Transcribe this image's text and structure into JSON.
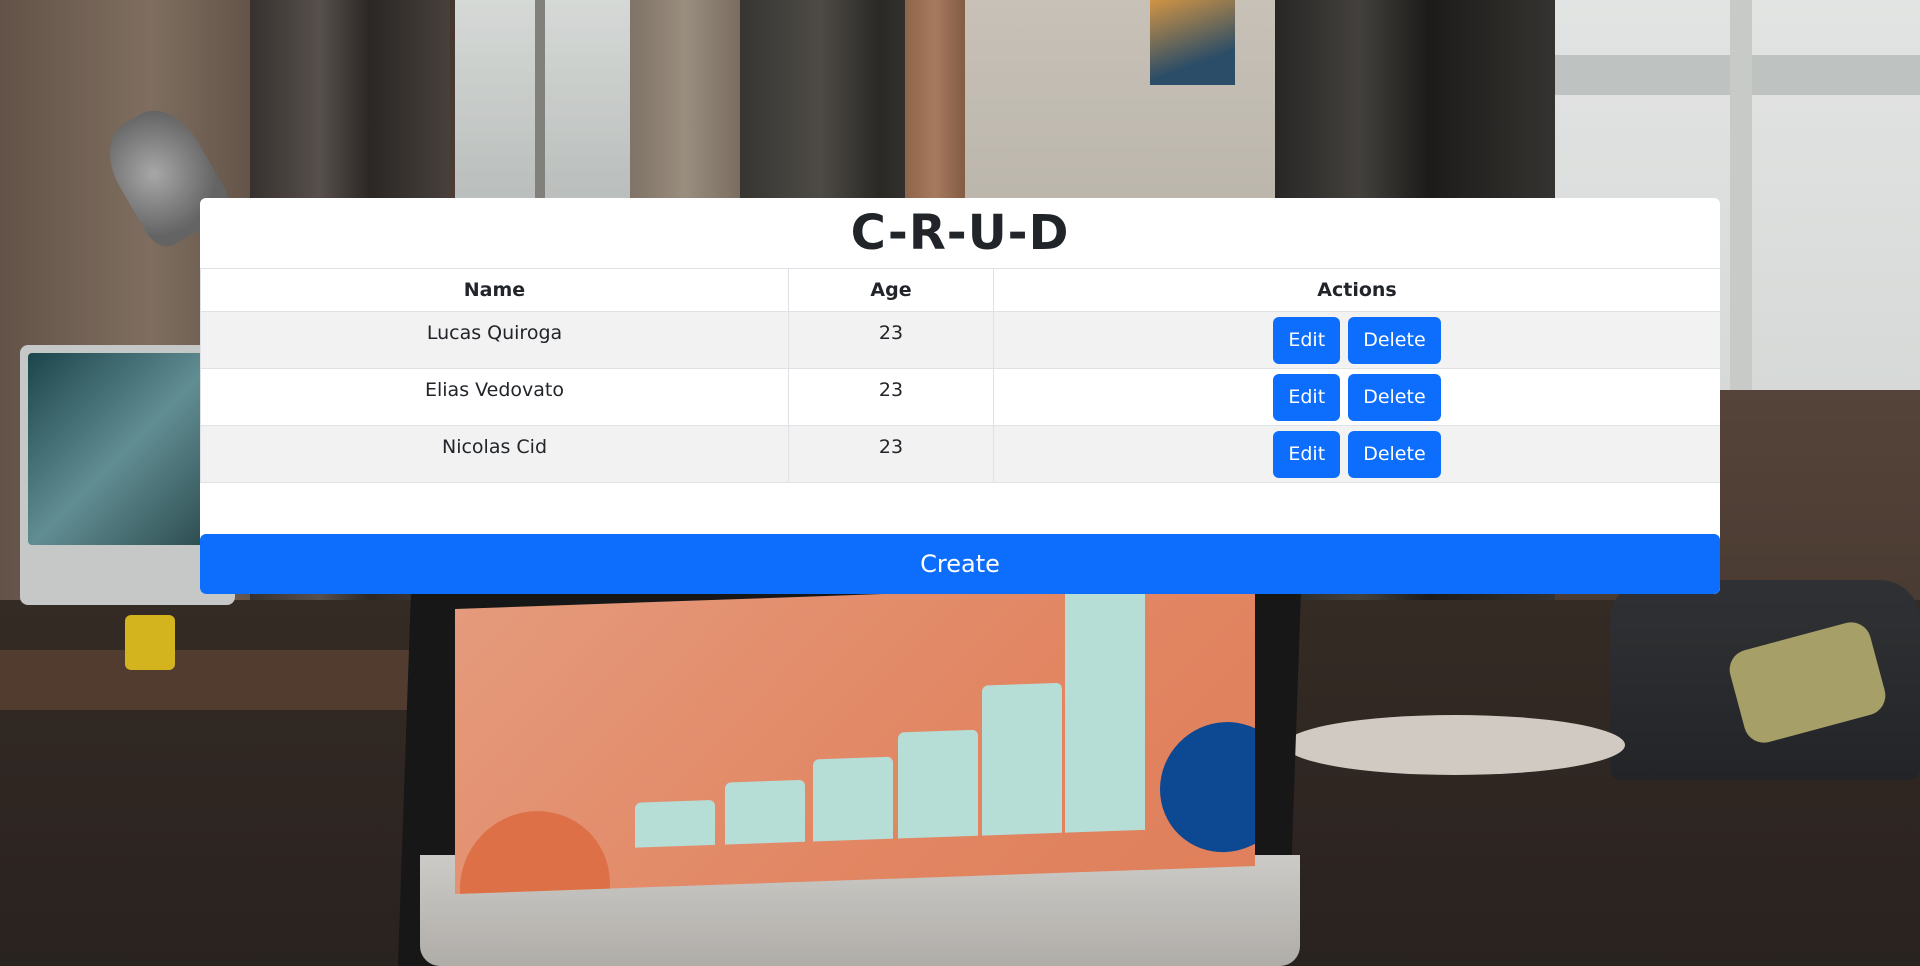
{
  "app": {
    "title": "C-R-U-D"
  },
  "table": {
    "columns": [
      "Name",
      "Age",
      "Actions"
    ],
    "rows": [
      {
        "name": "Lucas Quiroga",
        "age": "23",
        "edit_label": "Edit",
        "delete_label": "Delete"
      },
      {
        "name": "Elias Vedovato",
        "age": "23",
        "edit_label": "Edit",
        "delete_label": "Delete"
      },
      {
        "name": "Nicolas Cid",
        "age": "23",
        "edit_label": "Edit",
        "delete_label": "Delete"
      }
    ]
  },
  "create_button": {
    "label": "Create"
  },
  "colors": {
    "primary": "#0d6efd",
    "card": "#ffffff",
    "stripe": "#f2f2f2",
    "text": "#212529"
  }
}
